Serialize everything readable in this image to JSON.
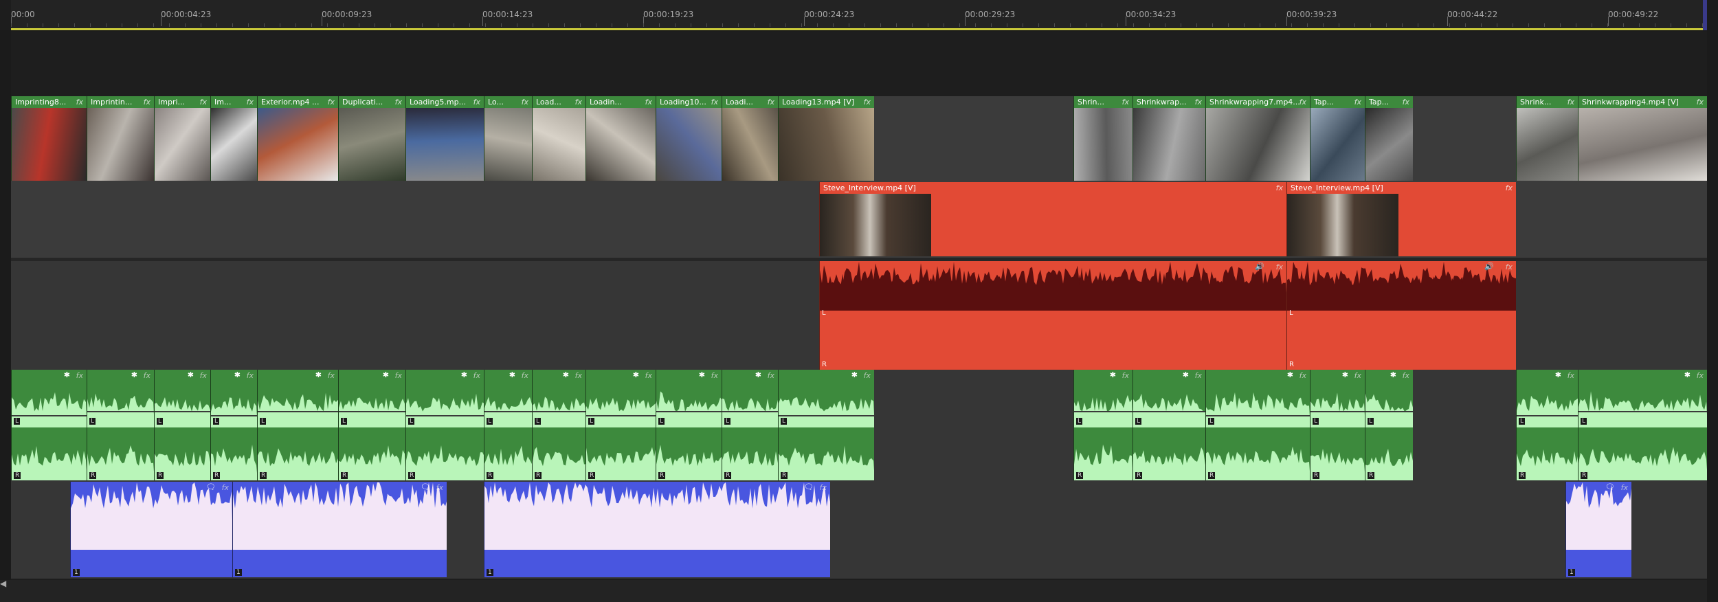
{
  "ruler": {
    "labels": [
      "00:00",
      "00:00:04:23",
      "00:00:09:23",
      "00:00:14:23",
      "00:00:19:23",
      "00:00:24:23",
      "00:00:29:23",
      "00:00:34:23",
      "00:00:39:23",
      "00:00:44:22",
      "00:00:49:22"
    ]
  },
  "colors": {
    "video_clip": "#3f8b3f",
    "interview_clip": "#e24a35",
    "music_clip": "#4956e0",
    "waveform_green": "#b9f5b9",
    "waveform_red": "#5a0f0f",
    "waveform_blue": "#f3e6f7",
    "ruler_line": "#c9c93a"
  },
  "video_track_2": {
    "clips": [
      {
        "label": "Imprinting8..."
      },
      {
        "label": "Imprintin..."
      },
      {
        "label": "Impri..."
      },
      {
        "label": "Im..."
      },
      {
        "label": "Exterior.mp4 ..."
      },
      {
        "label": "Duplicati..."
      },
      {
        "label": "Loading5.mp..."
      },
      {
        "label": "Lo..."
      },
      {
        "label": "Load..."
      },
      {
        "label": "Loadin..."
      },
      {
        "label": "Loading10..."
      },
      {
        "label": "Loadi..."
      },
      {
        "label": "Loading13.mp4 [V]"
      },
      {
        "label": "Shrin..."
      },
      {
        "label": "Shrinkwrap..."
      },
      {
        "label": "Shrinkwrapping7.mp4..."
      },
      {
        "label": "Tap..."
      },
      {
        "label": "Tap..."
      },
      {
        "label": "Shrink..."
      },
      {
        "label": "Shrinkwrapping4.mp4 [V]"
      }
    ]
  },
  "video_track_1": {
    "clips": [
      {
        "label": "Steve_Interview.mp4 [V]"
      },
      {
        "label": "Steve_Interview.mp4 [V]"
      }
    ]
  },
  "interview_audio": {
    "channels": [
      "L",
      "R"
    ]
  },
  "broll_audio": {
    "channels": [
      "L",
      "R"
    ]
  },
  "music_track": {
    "channel_label": "1"
  },
  "icons": {
    "fx": "fx",
    "keyframe": "*",
    "voice": "voice-icon",
    "speaker": "speaker-icon"
  },
  "fx_label": "fx",
  "keyframe_glyph": "✱"
}
